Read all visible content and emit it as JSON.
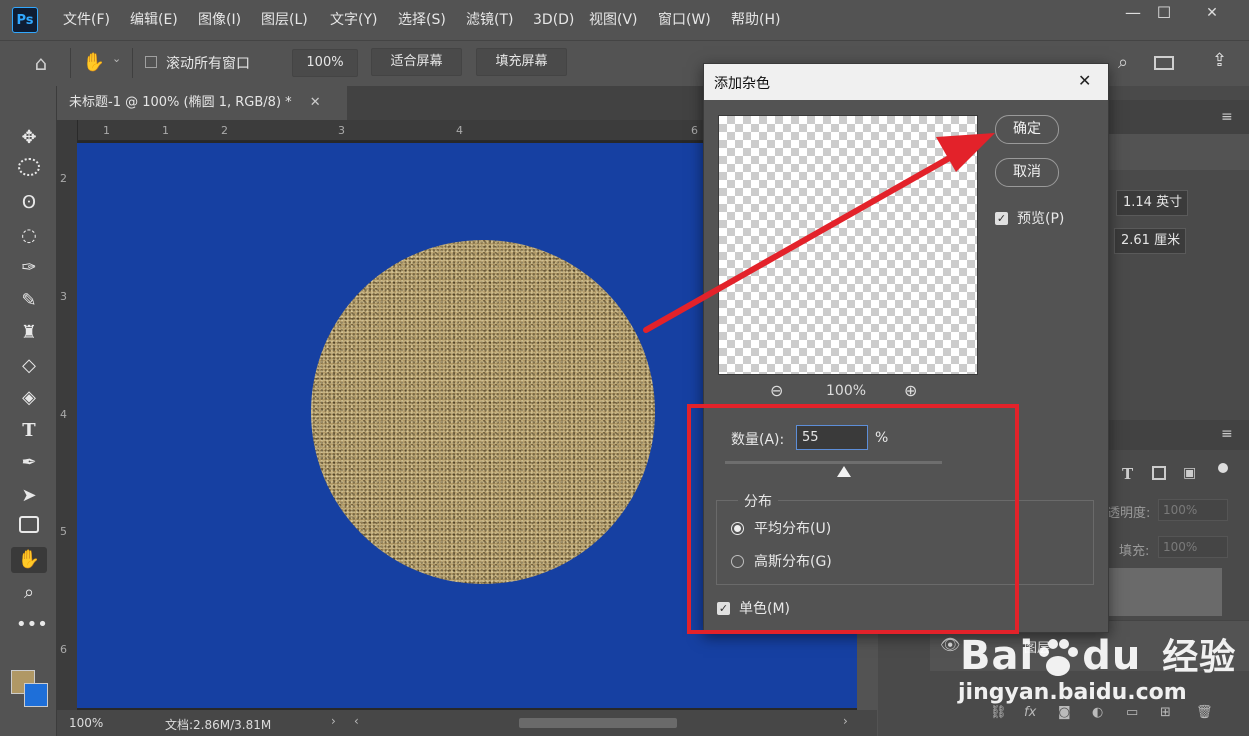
{
  "app": {
    "logo": "Ps",
    "menu": [
      "文件(F)",
      "编辑(E)",
      "图像(I)",
      "图层(L)",
      "文字(Y)",
      "选择(S)",
      "滤镜(T)",
      "3D(D)",
      "视图(V)",
      "窗口(W)",
      "帮助(H)"
    ]
  },
  "window_controls": {
    "minimize": "—",
    "maximize": "☐",
    "close": "✕"
  },
  "options_bar": {
    "scroll_all_label": "滚动所有窗口",
    "zoom_value": "100%",
    "fit_screen": "适合屏幕",
    "fill_screen": "填充屏幕"
  },
  "document": {
    "tab_title": "未标题-1 @ 100% (椭圆 1, RGB/8) *",
    "h_ruler": [
      "1",
      "1",
      "2",
      "3",
      "4",
      "6"
    ],
    "v_ruler": [
      "2",
      "3",
      "4",
      "5",
      "6"
    ]
  },
  "status_bar": {
    "zoom": "100%",
    "doc_info": "文档:2.86M/3.81M"
  },
  "properties_panel": {
    "width_value": "1.14 英寸",
    "height_value": "2.61 厘米"
  },
  "layers_panel": {
    "opacity_label": "透明度:",
    "opacity_value": "100%",
    "fill_label": "填充:",
    "fill_value": "100%",
    "layer_name": "图层"
  },
  "dialog": {
    "title": "添加杂色",
    "ok": "确定",
    "cancel": "取消",
    "preview_label": "预览(P)",
    "preview_checked": true,
    "zoom_value": "100%",
    "amount_label": "数量(A):",
    "amount_value": "55",
    "amount_unit": "%",
    "amount_fraction": 0.55,
    "distribution_legend": "分布",
    "uniform_label": "平均分布(U)",
    "gaussian_label": "高斯分布(G)",
    "selected_distribution": "uniform",
    "mono_label": "单色(M)",
    "mono_checked": true
  },
  "colors": {
    "canvas_blue": "#1640a2",
    "noise_gold": "#b09865",
    "annotation_red": "#e3222a",
    "foreground": "#b09865",
    "background": "#1e6fd9"
  },
  "watermark": {
    "brand": "Bai du 经验",
    "url": "jingyan.baidu.com"
  }
}
